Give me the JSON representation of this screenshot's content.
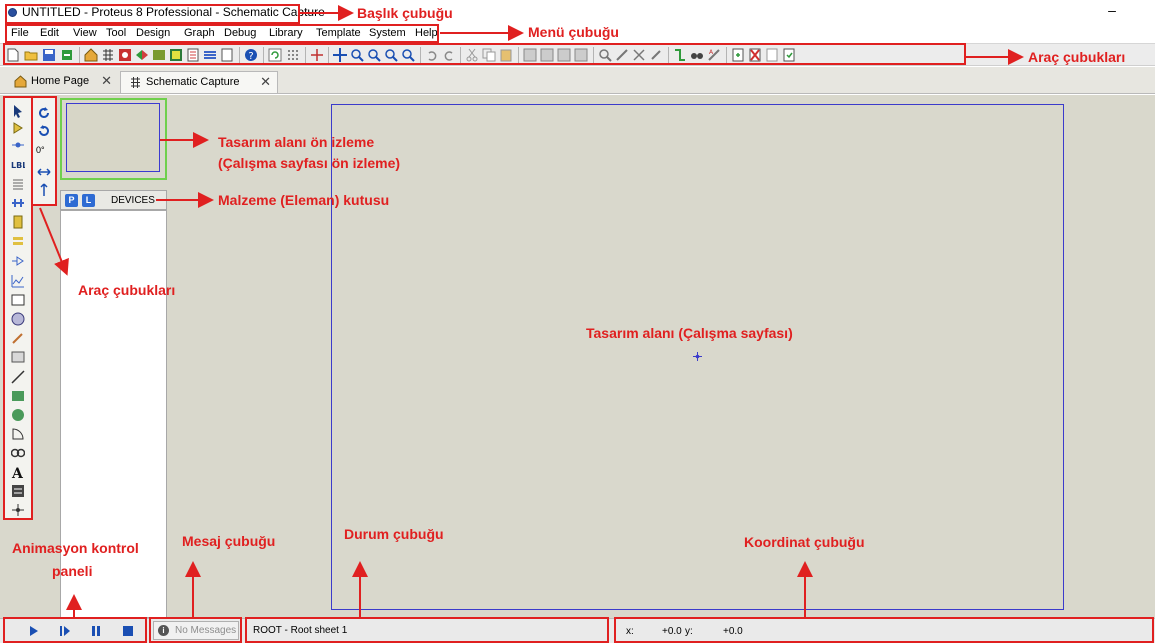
{
  "window": {
    "title": "UNTITLED - Proteus 8 Professional - Schematic Capture",
    "minimize": "–"
  },
  "menu": [
    "File",
    "Edit",
    "View",
    "Tool",
    "Design",
    "Graph",
    "Debug",
    "Library",
    "Template",
    "System",
    "Help"
  ],
  "tabs": [
    {
      "label": "Home Page",
      "icon": "home-icon",
      "close": "✕"
    },
    {
      "label": "Schematic Capture",
      "icon": "schematic-icon",
      "close": "✕"
    }
  ],
  "rotation": {
    "angle": "0°"
  },
  "devices": {
    "p_label": "P",
    "l_label": "L",
    "title": "DEVICES"
  },
  "statusbar": {
    "messages": "No Messages",
    "status": "ROOT - Root sheet 1",
    "x_label": "x:",
    "x_value": "+0.0",
    "y_label": "y:",
    "y_value": "+0.0"
  },
  "annotations": {
    "title_bar": "Başlık çubuğu",
    "menu_bar": "Menü çubuğu",
    "toolbars_top": "Araç çubukları",
    "preview_line1": "Tasarım alanı ön izleme",
    "preview_line2": "(Çalışma sayfası ön izleme)",
    "device_box": "Malzeme (Eleman) kutusu",
    "toolbars_left": "Araç çubukları",
    "design_area": "Tasarım alanı (Çalışma sayfası)",
    "animation_line1": "Animasyon kontrol",
    "animation_line2": "paneli",
    "message_bar": "Mesaj çubuğu",
    "status_bar": "Durum çubuğu",
    "coordinate_bar": "Koordinat çubuğu"
  },
  "colors": {
    "annotation": "#e02020",
    "workspace": "#d9d8cc",
    "sheet_border": "#3b3bcb",
    "preview_border": "#6fd04c"
  }
}
